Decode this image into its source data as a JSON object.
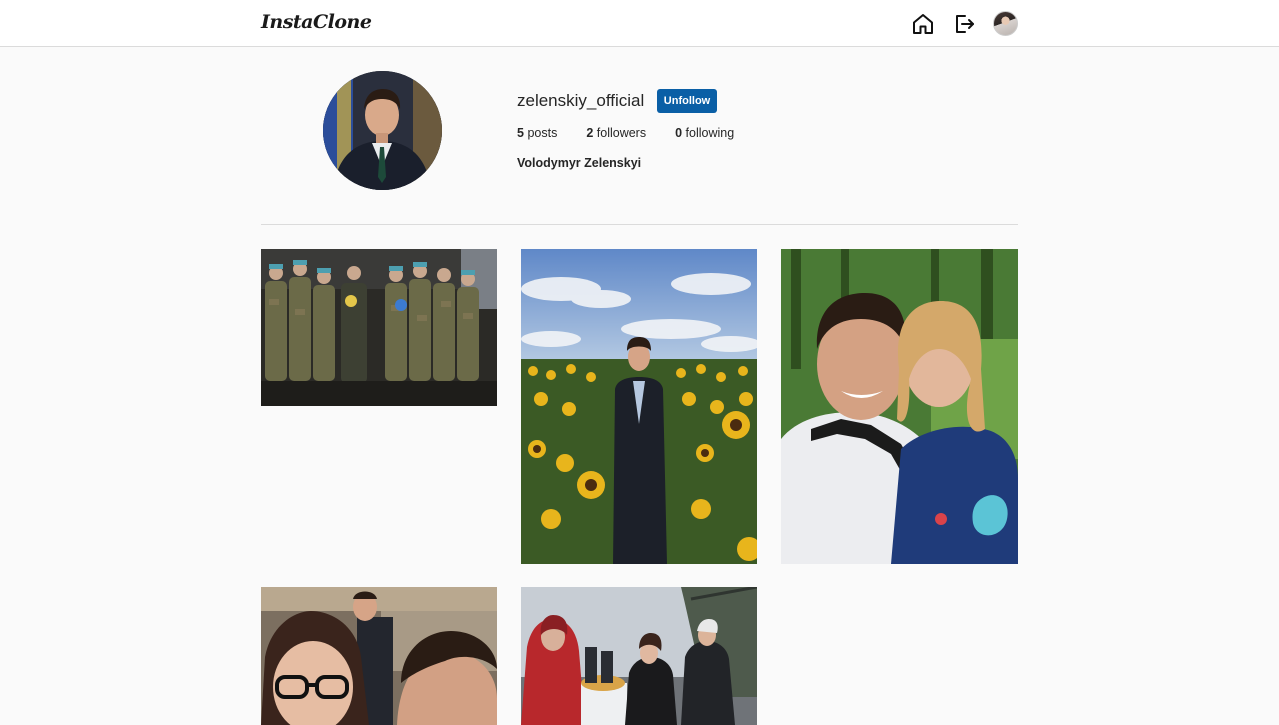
{
  "app": {
    "logo": "InstaClone"
  },
  "nav": {
    "home_icon": "home-icon",
    "logout_icon": "logout-icon",
    "avatar_icon": "user-avatar"
  },
  "profile": {
    "username": "zelenskiy_official",
    "follow_button_label": "Unfollow",
    "full_name": "Volodymyr Zelenskyi",
    "stats": [
      {
        "count": "5",
        "label": "posts"
      },
      {
        "count": "2",
        "label": "followers"
      },
      {
        "count": "0",
        "label": "following"
      }
    ]
  },
  "posts": [
    {
      "id": "post-1"
    },
    {
      "id": "post-2"
    },
    {
      "id": "post-3"
    },
    {
      "id": "post-4"
    },
    {
      "id": "post-5"
    }
  ],
  "colors": {
    "accent": "#0a5fa6",
    "background": "#fafafa",
    "border": "#dbdbdb"
  }
}
